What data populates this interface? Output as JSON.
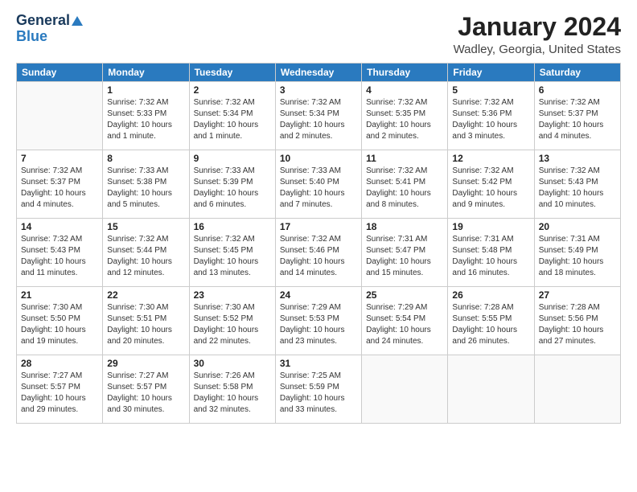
{
  "logo": {
    "line1": "General",
    "line2": "Blue"
  },
  "header": {
    "month": "January 2024",
    "location": "Wadley, Georgia, United States"
  },
  "weekdays": [
    "Sunday",
    "Monday",
    "Tuesday",
    "Wednesday",
    "Thursday",
    "Friday",
    "Saturday"
  ],
  "weeks": [
    [
      {
        "day": "",
        "sunrise": "",
        "sunset": "",
        "daylight": ""
      },
      {
        "day": "1",
        "sunrise": "Sunrise: 7:32 AM",
        "sunset": "Sunset: 5:33 PM",
        "daylight": "Daylight: 10 hours and 1 minute."
      },
      {
        "day": "2",
        "sunrise": "Sunrise: 7:32 AM",
        "sunset": "Sunset: 5:34 PM",
        "daylight": "Daylight: 10 hours and 1 minute."
      },
      {
        "day": "3",
        "sunrise": "Sunrise: 7:32 AM",
        "sunset": "Sunset: 5:34 PM",
        "daylight": "Daylight: 10 hours and 2 minutes."
      },
      {
        "day": "4",
        "sunrise": "Sunrise: 7:32 AM",
        "sunset": "Sunset: 5:35 PM",
        "daylight": "Daylight: 10 hours and 2 minutes."
      },
      {
        "day": "5",
        "sunrise": "Sunrise: 7:32 AM",
        "sunset": "Sunset: 5:36 PM",
        "daylight": "Daylight: 10 hours and 3 minutes."
      },
      {
        "day": "6",
        "sunrise": "Sunrise: 7:32 AM",
        "sunset": "Sunset: 5:37 PM",
        "daylight": "Daylight: 10 hours and 4 minutes."
      }
    ],
    [
      {
        "day": "7",
        "sunrise": "Sunrise: 7:32 AM",
        "sunset": "Sunset: 5:37 PM",
        "daylight": "Daylight: 10 hours and 4 minutes."
      },
      {
        "day": "8",
        "sunrise": "Sunrise: 7:33 AM",
        "sunset": "Sunset: 5:38 PM",
        "daylight": "Daylight: 10 hours and 5 minutes."
      },
      {
        "day": "9",
        "sunrise": "Sunrise: 7:33 AM",
        "sunset": "Sunset: 5:39 PM",
        "daylight": "Daylight: 10 hours and 6 minutes."
      },
      {
        "day": "10",
        "sunrise": "Sunrise: 7:33 AM",
        "sunset": "Sunset: 5:40 PM",
        "daylight": "Daylight: 10 hours and 7 minutes."
      },
      {
        "day": "11",
        "sunrise": "Sunrise: 7:32 AM",
        "sunset": "Sunset: 5:41 PM",
        "daylight": "Daylight: 10 hours and 8 minutes."
      },
      {
        "day": "12",
        "sunrise": "Sunrise: 7:32 AM",
        "sunset": "Sunset: 5:42 PM",
        "daylight": "Daylight: 10 hours and 9 minutes."
      },
      {
        "day": "13",
        "sunrise": "Sunrise: 7:32 AM",
        "sunset": "Sunset: 5:43 PM",
        "daylight": "Daylight: 10 hours and 10 minutes."
      }
    ],
    [
      {
        "day": "14",
        "sunrise": "Sunrise: 7:32 AM",
        "sunset": "Sunset: 5:43 PM",
        "daylight": "Daylight: 10 hours and 11 minutes."
      },
      {
        "day": "15",
        "sunrise": "Sunrise: 7:32 AM",
        "sunset": "Sunset: 5:44 PM",
        "daylight": "Daylight: 10 hours and 12 minutes."
      },
      {
        "day": "16",
        "sunrise": "Sunrise: 7:32 AM",
        "sunset": "Sunset: 5:45 PM",
        "daylight": "Daylight: 10 hours and 13 minutes."
      },
      {
        "day": "17",
        "sunrise": "Sunrise: 7:32 AM",
        "sunset": "Sunset: 5:46 PM",
        "daylight": "Daylight: 10 hours and 14 minutes."
      },
      {
        "day": "18",
        "sunrise": "Sunrise: 7:31 AM",
        "sunset": "Sunset: 5:47 PM",
        "daylight": "Daylight: 10 hours and 15 minutes."
      },
      {
        "day": "19",
        "sunrise": "Sunrise: 7:31 AM",
        "sunset": "Sunset: 5:48 PM",
        "daylight": "Daylight: 10 hours and 16 minutes."
      },
      {
        "day": "20",
        "sunrise": "Sunrise: 7:31 AM",
        "sunset": "Sunset: 5:49 PM",
        "daylight": "Daylight: 10 hours and 18 minutes."
      }
    ],
    [
      {
        "day": "21",
        "sunrise": "Sunrise: 7:30 AM",
        "sunset": "Sunset: 5:50 PM",
        "daylight": "Daylight: 10 hours and 19 minutes."
      },
      {
        "day": "22",
        "sunrise": "Sunrise: 7:30 AM",
        "sunset": "Sunset: 5:51 PM",
        "daylight": "Daylight: 10 hours and 20 minutes."
      },
      {
        "day": "23",
        "sunrise": "Sunrise: 7:30 AM",
        "sunset": "Sunset: 5:52 PM",
        "daylight": "Daylight: 10 hours and 22 minutes."
      },
      {
        "day": "24",
        "sunrise": "Sunrise: 7:29 AM",
        "sunset": "Sunset: 5:53 PM",
        "daylight": "Daylight: 10 hours and 23 minutes."
      },
      {
        "day": "25",
        "sunrise": "Sunrise: 7:29 AM",
        "sunset": "Sunset: 5:54 PM",
        "daylight": "Daylight: 10 hours and 24 minutes."
      },
      {
        "day": "26",
        "sunrise": "Sunrise: 7:28 AM",
        "sunset": "Sunset: 5:55 PM",
        "daylight": "Daylight: 10 hours and 26 minutes."
      },
      {
        "day": "27",
        "sunrise": "Sunrise: 7:28 AM",
        "sunset": "Sunset: 5:56 PM",
        "daylight": "Daylight: 10 hours and 27 minutes."
      }
    ],
    [
      {
        "day": "28",
        "sunrise": "Sunrise: 7:27 AM",
        "sunset": "Sunset: 5:57 PM",
        "daylight": "Daylight: 10 hours and 29 minutes."
      },
      {
        "day": "29",
        "sunrise": "Sunrise: 7:27 AM",
        "sunset": "Sunset: 5:57 PM",
        "daylight": "Daylight: 10 hours and 30 minutes."
      },
      {
        "day": "30",
        "sunrise": "Sunrise: 7:26 AM",
        "sunset": "Sunset: 5:58 PM",
        "daylight": "Daylight: 10 hours and 32 minutes."
      },
      {
        "day": "31",
        "sunrise": "Sunrise: 7:25 AM",
        "sunset": "Sunset: 5:59 PM",
        "daylight": "Daylight: 10 hours and 33 minutes."
      },
      {
        "day": "",
        "sunrise": "",
        "sunset": "",
        "daylight": ""
      },
      {
        "day": "",
        "sunrise": "",
        "sunset": "",
        "daylight": ""
      },
      {
        "day": "",
        "sunrise": "",
        "sunset": "",
        "daylight": ""
      }
    ]
  ]
}
